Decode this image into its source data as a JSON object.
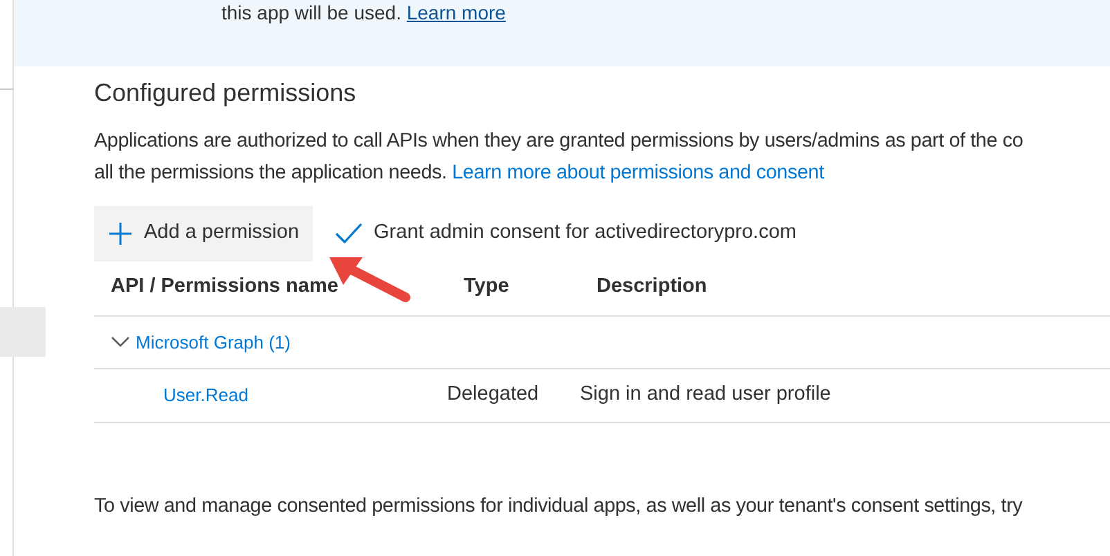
{
  "banner": {
    "text": "this app will be used.",
    "link": "Learn more"
  },
  "section": {
    "title": "Configured permissions",
    "intro_line_1": "Applications are authorized to call APIs when they are granted permissions by users/admins as part of the co",
    "intro_line_2": "all the permissions the application needs.",
    "intro_link": "Learn more about permissions and consent"
  },
  "toolbar": [
    {
      "kind": "add",
      "label": "Add a permission",
      "highlighted": true
    },
    {
      "kind": "grant",
      "label": "Grant admin consent for activedirectorypro.com",
      "highlighted": false
    }
  ],
  "table": {
    "columns": [
      "API / Permissions name",
      "Type",
      "Description"
    ],
    "groups": [
      {
        "name": "Microsoft Graph (1)",
        "expanded": true,
        "rows": [
          {
            "name": "User.Read",
            "type": "Delegated",
            "description": "Sign in and read user profile"
          }
        ]
      }
    ]
  },
  "footer": "To view and manage consented permissions for individual apps, as well as your tenant's consent settings, try"
}
